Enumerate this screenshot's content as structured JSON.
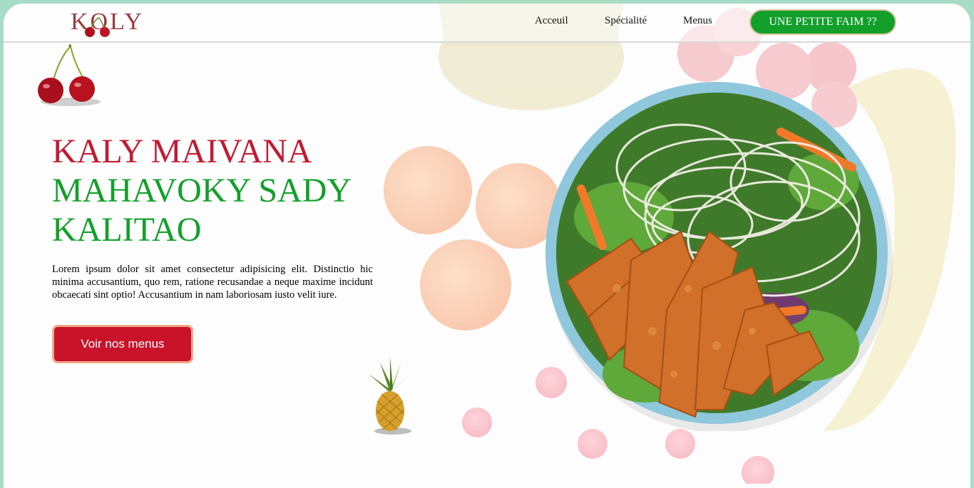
{
  "brand": {
    "logo_text": "KOLY"
  },
  "nav": {
    "items": [
      {
        "label": "Acceuil"
      },
      {
        "label": "Spécialité"
      },
      {
        "label": "Menus"
      }
    ],
    "cta_label": "UNE PETITE FAIM ??"
  },
  "hero": {
    "title_line1": "KALY MAIVANA",
    "title_line2": "MAHAVOKY SADY",
    "title_line3": "KALITAO",
    "description": "Lorem ipsum dolor sit amet consectetur adipisicing elit. Distinctio hic minima accusantium, quo rem, ratione recusandae a neque maxime incidunt obcaecati sint optio! Accusantium in nam laboriosam iusto velit iure.",
    "cta_label": "Voir nos menus"
  },
  "images": {
    "cherries": "cherries-icon",
    "pineapple": "pineapple-icon",
    "bowl": "chicken-noodle-salad-bowl-image",
    "background": "fruit-background-image"
  },
  "colors": {
    "accent_red": "#c21a32",
    "accent_green": "#12a02a",
    "frame": "#a8dcc5",
    "button_red": "#c8132a"
  }
}
